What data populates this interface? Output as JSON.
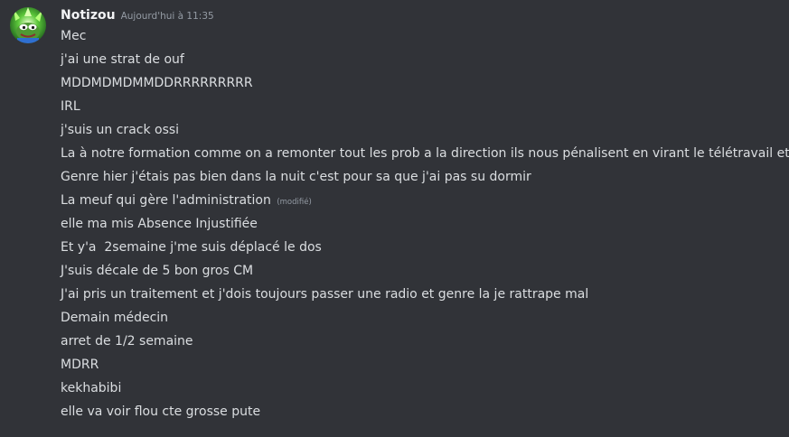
{
  "message": {
    "username": "Notizou",
    "timestamp": "Aujourd'hui à 11:35",
    "edited_label": "(modifié)",
    "lines": [
      "Mec",
      "j'ai une strat de ouf",
      "MDDMDMDMMDDRRRRRRRRR",
      "IRL",
      "j'suis un crack ossi",
      "La à notre formation comme on a remonter tout les prob a la direction ils nous pénalisent en virant le télétravail etc",
      "Genre hier j'étais pas bien dans la nuit c'est pour sa que j'ai pas su dormir",
      "La meuf qui gère l'administration",
      "elle ma mis Absence Injustifiée",
      "Et y'a  2semaine j'me suis déplacé le dos",
      "J'suis décale de 5 bon gros CM",
      "J'ai pris un traitement et j'dois toujours passer une radio et genre la je rattrape mal",
      "Demain médecin",
      "arret de 1/2 semaine",
      "MDRR",
      "kekhabibi",
      "elle va voir flou cte grosse pute"
    ]
  },
  "colors": {
    "background": "#313338",
    "username": "#f2f3f5",
    "text": "#dbdee1",
    "muted": "#949ba4"
  },
  "icons": {
    "avatar": "pepe-frog-avatar-icon"
  }
}
